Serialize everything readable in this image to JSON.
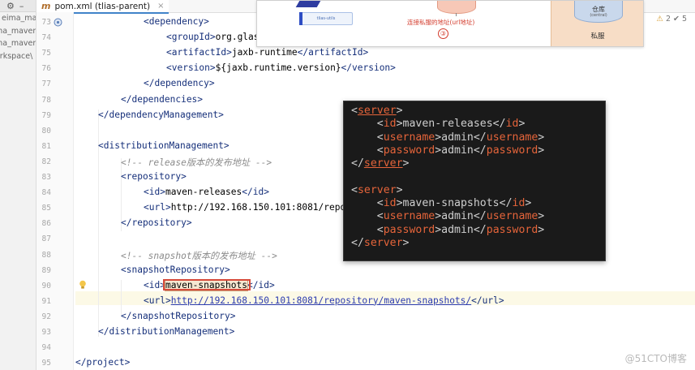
{
  "project_panel": {
    "items": [
      "eima_mave",
      "ma_maven_",
      "ma_maven_",
      "orkspace\\"
    ]
  },
  "editor_tab": {
    "icon": "m",
    "label": "pom.xml (tlias-parent)",
    "close": "×"
  },
  "inspections": {
    "warnings": "2",
    "info": "5"
  },
  "gutter": {
    "lines": [
      "73",
      "74",
      "75",
      "76",
      "77",
      "78",
      "79",
      "80",
      "81",
      "82",
      "83",
      "84",
      "85",
      "86",
      "87",
      "88",
      "89",
      "90",
      "91",
      "92",
      "93",
      "94",
      "95"
    ]
  },
  "code_lines": [
    [
      {
        "c": "tag",
        "t": "<dependency>"
      }
    ],
    [
      {
        "c": "tag",
        "t": "<groupId>"
      },
      {
        "c": "",
        "t": "org.glas"
      }
    ],
    [
      {
        "c": "tag",
        "t": "<artifactId>"
      },
      {
        "c": "",
        "t": "jaxb-runtime"
      },
      {
        "c": "tag",
        "t": "</artifactId>"
      }
    ],
    [
      {
        "c": "tag",
        "t": "<version>"
      },
      {
        "c": "",
        "t": "${jaxb.runtime.version}"
      },
      {
        "c": "tag",
        "t": "</version>"
      }
    ],
    [
      {
        "c": "tag",
        "t": "</dependency>"
      }
    ],
    [
      {
        "c": "tag",
        "t": "</dependencies>"
      }
    ],
    [
      {
        "c": "tag",
        "t": "</dependencyManagement>"
      }
    ],
    [],
    [
      {
        "c": "tag",
        "t": "<distributionManagement>"
      }
    ],
    [
      {
        "c": "cmt",
        "t": "<!-- release版本的发布地址 -->"
      }
    ],
    [
      {
        "c": "tag",
        "t": "<repository>"
      }
    ],
    [
      {
        "c": "tag",
        "t": "<id>"
      },
      {
        "c": "",
        "t": "maven-releases"
      },
      {
        "c": "tag",
        "t": "</id>"
      }
    ],
    [
      {
        "c": "tag",
        "t": "<url>"
      },
      {
        "c": "",
        "t": "http://192.168.150.101:8081/repo"
      }
    ],
    [
      {
        "c": "tag",
        "t": "</repository>"
      }
    ],
    [],
    [
      {
        "c": "cmt",
        "t": "<!-- snapshot版本的发布地址 -->"
      }
    ],
    [
      {
        "c": "tag",
        "t": "<snapshotRepository>"
      }
    ],
    [
      {
        "c": "tag",
        "t": "<id>"
      },
      {
        "c": "hl",
        "t": "maven-snapshots"
      },
      {
        "c": "tag",
        "t": "</id>"
      }
    ],
    [
      {
        "c": "tag",
        "t": "<url>"
      },
      {
        "c": "url",
        "t": "http://192.168.150.101:8081/repository/maven-snapshots/"
      },
      {
        "c": "tag",
        "t": "</url>"
      }
    ],
    [
      {
        "c": "tag",
        "t": "</snapshotRepository>"
      }
    ],
    [
      {
        "c": "tag",
        "t": "</distributionManagement>"
      }
    ],
    [],
    [
      {
        "c": "tag",
        "t": "</project>"
      }
    ]
  ],
  "diagram": {
    "chip_text": "tlias-utils",
    "label": "连接私服的地址(url地址)",
    "step": "③",
    "store_title": "仓库",
    "store_sub": "(central)",
    "private_label": "私服"
  },
  "popup_lines": [
    [
      {
        "c": "bt",
        "t": "<"
      },
      {
        "c": "pt ul",
        "t": "server"
      },
      {
        "c": "bt",
        "t": ">"
      }
    ],
    [
      {
        "c": "bt",
        "t": "    <"
      },
      {
        "c": "pt",
        "t": "id"
      },
      {
        "c": "bt",
        "t": ">maven-releases</"
      },
      {
        "c": "pt",
        "t": "id"
      },
      {
        "c": "bt",
        "t": ">"
      }
    ],
    [
      {
        "c": "bt",
        "t": "    <"
      },
      {
        "c": "pt",
        "t": "username"
      },
      {
        "c": "bt",
        "t": ">admin</"
      },
      {
        "c": "pt",
        "t": "username"
      },
      {
        "c": "bt",
        "t": ">"
      }
    ],
    [
      {
        "c": "bt",
        "t": "    <"
      },
      {
        "c": "pt",
        "t": "password"
      },
      {
        "c": "bt",
        "t": ">admin</"
      },
      {
        "c": "pt",
        "t": "password"
      },
      {
        "c": "bt",
        "t": ">"
      }
    ],
    [
      {
        "c": "bt",
        "t": "</"
      },
      {
        "c": "pt ul",
        "t": "server"
      },
      {
        "c": "bt",
        "t": ">"
      }
    ],
    [],
    [
      {
        "c": "bt",
        "t": "<"
      },
      {
        "c": "pt",
        "t": "server"
      },
      {
        "c": "bt",
        "t": ">"
      }
    ],
    [
      {
        "c": "bt",
        "t": "    <"
      },
      {
        "c": "pt",
        "t": "id"
      },
      {
        "c": "bt",
        "t": ">maven-snapshots</"
      },
      {
        "c": "pt",
        "t": "id"
      },
      {
        "c": "bt",
        "t": ">"
      }
    ],
    [
      {
        "c": "bt",
        "t": "    <"
      },
      {
        "c": "pt",
        "t": "username"
      },
      {
        "c": "bt",
        "t": ">admin</"
      },
      {
        "c": "pt",
        "t": "username"
      },
      {
        "c": "bt",
        "t": ">"
      }
    ],
    [
      {
        "c": "bt",
        "t": "    <"
      },
      {
        "c": "pt",
        "t": "password"
      },
      {
        "c": "bt",
        "t": ">admin</"
      },
      {
        "c": "pt",
        "t": "password"
      },
      {
        "c": "bt",
        "t": ">"
      }
    ],
    [
      {
        "c": "bt",
        "t": "</"
      },
      {
        "c": "pt",
        "t": "server"
      },
      {
        "c": "bt",
        "t": ">"
      }
    ]
  ],
  "watermark": "@51CTO博客",
  "colors": {
    "tag": "#152f7a",
    "comment": "#8c8c8c",
    "popup_tag": "#e5643a",
    "tab_accent": "#4083c9"
  }
}
